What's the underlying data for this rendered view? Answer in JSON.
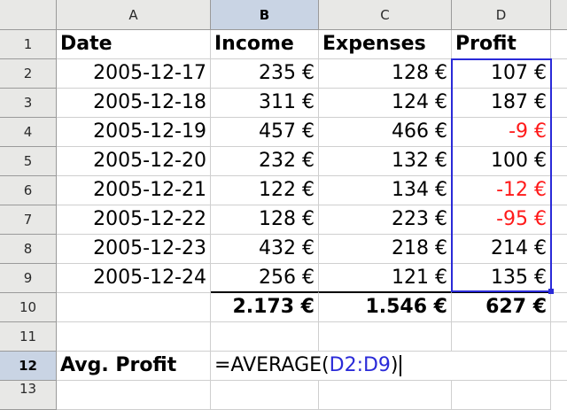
{
  "columns": [
    "A",
    "B",
    "C",
    "D"
  ],
  "rows": [
    "1",
    "2",
    "3",
    "4",
    "5",
    "6",
    "7",
    "8",
    "9",
    "10",
    "11",
    "12",
    "13"
  ],
  "header": {
    "a": "Date",
    "b": "Income",
    "c": "Expenses",
    "d": "Profit"
  },
  "data_rows": [
    {
      "date": "2005-12-17",
      "income": "235 €",
      "expenses": "128 €",
      "profit": "107 €",
      "profit_negative": false
    },
    {
      "date": "2005-12-18",
      "income": "311 €",
      "expenses": "124 €",
      "profit": "187 €",
      "profit_negative": false
    },
    {
      "date": "2005-12-19",
      "income": "457 €",
      "expenses": "466 €",
      "profit": "-9 €",
      "profit_negative": true
    },
    {
      "date": "2005-12-20",
      "income": "232 €",
      "expenses": "132 €",
      "profit": "100 €",
      "profit_negative": false
    },
    {
      "date": "2005-12-21",
      "income": "122 €",
      "expenses": "134 €",
      "profit": "-12 €",
      "profit_negative": true
    },
    {
      "date": "2005-12-22",
      "income": "128 €",
      "expenses": "223 €",
      "profit": "-95 €",
      "profit_negative": true
    },
    {
      "date": "2005-12-23",
      "income": "432 €",
      "expenses": "218 €",
      "profit": "214 €",
      "profit_negative": false
    },
    {
      "date": "2005-12-24",
      "income": "256 €",
      "expenses": "121 €",
      "profit": "135 €",
      "profit_negative": false
    }
  ],
  "totals": {
    "income": "2.173 €",
    "expenses": "1.546 €",
    "profit": "627 €"
  },
  "avg_row": {
    "label": "Avg. Profit",
    "formula_prefix": "=AVERAGE(",
    "formula_range": "D2:D9",
    "formula_suffix": ")"
  },
  "colors": {
    "negative": "#ff1a1a",
    "reference": "#2a2ad8",
    "selected_header": "#c9d4e4"
  }
}
